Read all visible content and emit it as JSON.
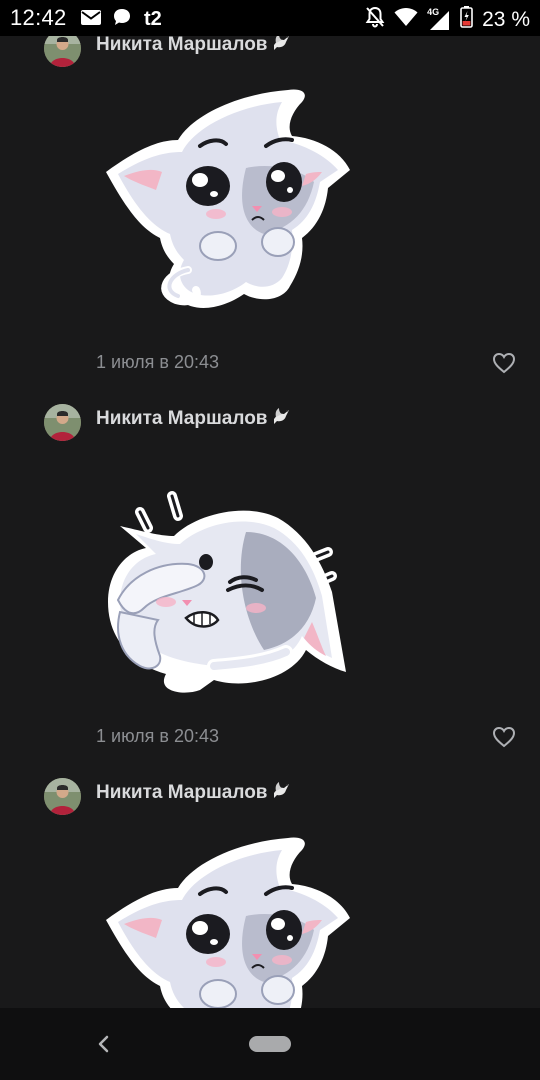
{
  "status_bar": {
    "time": "12:42",
    "carrier": "t2",
    "network": "4G",
    "battery_percent": "23 %",
    "icons": [
      "mail-icon",
      "chat-bubble-icon",
      "mute-icon",
      "wifi-icon",
      "signal-icon",
      "battery-icon"
    ]
  },
  "posts": [
    {
      "author": "Никита Маршалов",
      "author_badge_icon": "dove-icon",
      "sticker": "sad-cat-sticker",
      "date": "1 июля в 20:43"
    },
    {
      "author": "Никита Маршалов",
      "author_badge_icon": "dove-icon",
      "sticker": "facepalm-cat-sticker",
      "date": "1 июля в 20:43"
    },
    {
      "author": "Никита Маршалов",
      "author_badge_icon": "dove-icon",
      "sticker": "sad-cat-sticker"
    }
  ],
  "nav_bar": {
    "icons": [
      "back-icon",
      "home-pill-icon"
    ]
  },
  "colors": {
    "background": "#19191a",
    "author_text": "#d9dadc",
    "date_text": "#8c8e92",
    "status_bar": "#000000"
  }
}
